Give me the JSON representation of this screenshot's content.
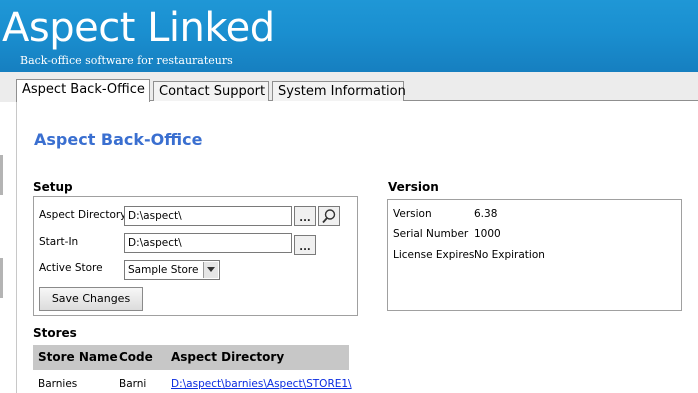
{
  "banner": {
    "title": "Aspect Linked",
    "subtitle": "Back-office software for restaurateurs"
  },
  "tabs": [
    {
      "label": "Aspect Back-Office",
      "active": true
    },
    {
      "label": "Contact Support",
      "active": false
    },
    {
      "label": "System Information",
      "active": false
    }
  ],
  "page": {
    "title": "Aspect Back-Office"
  },
  "setup": {
    "title": "Setup",
    "aspect_directory": {
      "label": "Aspect Directory",
      "value": "D:\\aspect\\"
    },
    "start_in": {
      "label": "Start-In",
      "value": "D:\\aspect\\"
    },
    "active_store": {
      "label": "Active Store",
      "value": "Sample Store"
    },
    "browse_label": "...",
    "save_label": "Save Changes"
  },
  "version": {
    "title": "Version",
    "rows": [
      {
        "label": "Version",
        "value": "6.38"
      },
      {
        "label": "Serial Number",
        "value": "1000"
      },
      {
        "label": "License Expires",
        "value": "No Expiration"
      }
    ]
  },
  "stores": {
    "title": "Stores",
    "columns": [
      "Store Name",
      "Code",
      "Aspect Directory"
    ],
    "rows": [
      {
        "name": "Barnies",
        "code": "Barni",
        "directory": "D:\\aspect\\barnies\\Aspect\\STORE1\\"
      }
    ]
  },
  "colors": {
    "banner": "#1a8fd0",
    "page_title": "#3a6fd0",
    "link": "#0a2be0",
    "table_header": "#c7c7c7"
  }
}
